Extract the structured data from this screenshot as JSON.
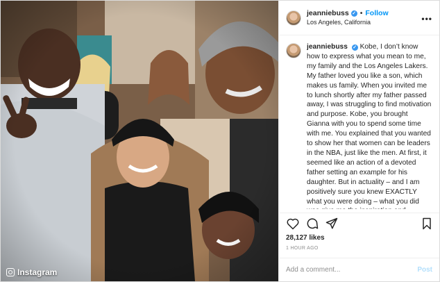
{
  "photo": {
    "alt": "Group selfie photo",
    "watermark": "Instagram"
  },
  "header": {
    "username": "jeanniebuss",
    "verified_mark": "✓",
    "separator": "•",
    "follow_label": "Follow",
    "location": "Los Angeles, California",
    "more_icon": "•••"
  },
  "caption": {
    "username": "jeanniebuss",
    "verified_mark": "✓",
    "text": "Kobe, I don’t know how to express what you mean to me, my family and the Los Angeles Lakers. My father loved you like a son, which makes us family. When you invited me to lunch shortly after my father passed away, I was struggling to find motivation and purpose. Kobe, you brought Gianna with you to spend some time with me. You explained that you wanted to show her that women can be leaders in the NBA, just like the men. At first, it seemed like an action of a devoted father setting an example for his daughter. But in actuality – and I am positively sure you knew EXACTLY what you were doing – what you did was give me the inspiration and strength I was needing for inflection that..."
  },
  "actions": {
    "like_icon": "heart-icon",
    "comment_icon": "comment-icon",
    "share_icon": "share-icon",
    "save_icon": "bookmark-icon"
  },
  "likes": "28,127 likes",
  "time": "1 HOUR AGO",
  "add_comment": {
    "placeholder": "Add a comment...",
    "post_label": "Post"
  },
  "colors": {
    "accent": "#0095f6",
    "verified": "#3897f0",
    "muted": "#8e8e8e",
    "post_disabled": "#b2dffc"
  }
}
